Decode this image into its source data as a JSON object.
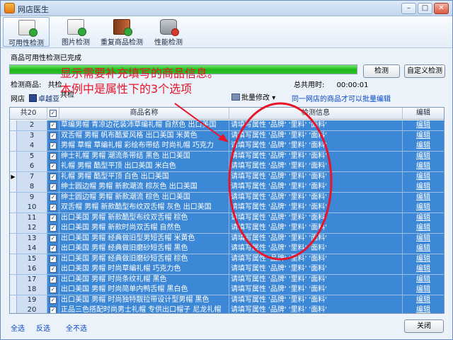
{
  "window": {
    "title": "网店医生"
  },
  "titlebar_buttons": {
    "minimize": "–",
    "maximize": "□",
    "close": "✕"
  },
  "toolbar": [
    {
      "label": "可用性检测",
      "icon": "doc-check-icon"
    },
    {
      "label": "图片检测",
      "icon": "image-check-icon"
    },
    {
      "label": "重复商品检测",
      "icon": "book-check-icon"
    },
    {
      "label": "性能检测",
      "icon": "database-icon"
    }
  ],
  "status": {
    "text": "商品可用性检测已完成",
    "progress": 1.0
  },
  "buttons": {
    "detect": "检测",
    "custom_detect": "自定义检测",
    "close": "关闭"
  },
  "info": {
    "product_label": "检测商品:",
    "product_value": "共检",
    "time_label": "共检",
    "time_value": "00:00:01",
    "total_time_label": "总共用时:",
    "total_time_value": "00:00:01",
    "store_label": "网店",
    "store_name": "卓越亚",
    "batch_edit": "批量修改",
    "batch_edit_arrow": "▾",
    "batch_note": "同一网店的商品才可以批量编辑"
  },
  "grid": {
    "headers": {
      "count": "共20",
      "name": "商品名称",
      "info": "检测信息",
      "edit": "编辑"
    },
    "rows": [
      {
        "num": "2",
        "name": "草编男帽 青凉边花装沛草编礼帽 自然色 出口美国",
        "info": "请填写属性 '品牌' '里料' '面料'",
        "edit": "编辑"
      },
      {
        "num": "3",
        "name": "双舌帽 男帽 帆布酷爱风格 出口美国 米黄色",
        "info": "请填写属性 '品牌' '里料' '面料'",
        "edit": "编辑"
      },
      {
        "num": "4",
        "name": "男帽 草帽 草编礼帽 彩绘布带结 时尚礼帽 巧克力",
        "info": "请填写属性 '品牌' '里料' '面料'",
        "edit": "编辑"
      },
      {
        "num": "5",
        "name": "绅士礼帽 男帽 潮流条带结 黑色 出口美国",
        "info": "请填写属性 '品牌' '里料' '面料'",
        "edit": "编辑"
      },
      {
        "num": "6",
        "name": "礼帽 男帽 酷型平顶 出口美国 米白色",
        "info": "请填写属性 '品牌' '里料' '面料'",
        "edit": "编辑"
      },
      {
        "num": "7",
        "name": "礼帽 男帽 酷型平顶 白色 出口美国",
        "info": "请填写属性 '品牌' '里料' '面料'",
        "edit": "编辑"
      },
      {
        "num": "8",
        "name": "绅士圆边帽 男帽 新款潮流 棕灰色 出口美国",
        "info": "请填写属性 '品牌' '里料' '面料'",
        "edit": "编辑"
      },
      {
        "num": "9",
        "name": "绅士圆边帽 男帽 新款潮流 棕色 出口美国",
        "info": "请填写属性 '品牌' '里料' '面料'",
        "edit": "编辑"
      },
      {
        "num": "10",
        "name": "双舌帽 男帽 新款酷型布纹双舌帽 灰色 出口美国",
        "info": "请填写属性 '品牌' '里料' '面料'",
        "edit": "编辑"
      },
      {
        "num": "11",
        "name": "出口美国 男帽 新款酷型布纹双舌帽 棕色",
        "info": "请填写属性 '品牌' '里料' '面料'",
        "edit": "编辑"
      },
      {
        "num": "12",
        "name": "出口美国 男帽 新款时尚双舌帽 自然色",
        "info": "请填写属性 '品牌' '里料' '面料'",
        "edit": "编辑"
      },
      {
        "num": "13",
        "name": "出口美国 男帽 经典做旧型男短舌帽 米黄色",
        "info": "请填写属性 '品牌' '里料' '面料'",
        "edit": "编辑"
      },
      {
        "num": "14",
        "name": "出口美国 男帽 经典做旧磨砂短舌帽 黑色",
        "info": "请填写属性 '品牌' '里料' '面料'",
        "edit": "编辑"
      },
      {
        "num": "15",
        "name": "出口美国 男帽 经典做旧磨砂短舌帽 棕色",
        "info": "请填写属性 '品牌' '里料' '面料'",
        "edit": "编辑"
      },
      {
        "num": "16",
        "name": "出口美国 男帽 时尚草编礼帽 巧克力色",
        "info": "请填写属性 '品牌' '里料' '面料'",
        "edit": "编辑"
      },
      {
        "num": "17",
        "name": "出口美国 男帽 时尚条纹礼帽 黑色",
        "info": "请填写属性 '品牌' '里料' '面料'",
        "edit": "编辑"
      },
      {
        "num": "18",
        "name": "出口美国 男帽 时尚简单内鸭舌帽 黑白色",
        "info": "请填写属性 '品牌' '里料' '面料'",
        "edit": "编辑"
      },
      {
        "num": "19",
        "name": "出口美国 男帽 时尚独特靓拉带设计型男帽 黑色",
        "info": "请填写属性 '品牌' '里料' '面料'",
        "edit": "编辑"
      },
      {
        "num": "20",
        "name": "正品三色搭配时尚男士礼帽 专供出口帽子 尼龙礼帽",
        "info": "请填写属性 '品牌' '里料' '面料'",
        "edit": "编辑"
      }
    ],
    "current_row_marker": "▶"
  },
  "footer": {
    "select_all": "全选",
    "invert": "反选",
    "select_none": "全不选"
  },
  "annotation": {
    "line1": "显示需要补充填写的商品信息。",
    "line2": "本例中是属性下的3个选项"
  },
  "colors": {
    "row_selected": "#3c87d6",
    "annotation": "#e8142a",
    "progress": "#1fb619"
  }
}
